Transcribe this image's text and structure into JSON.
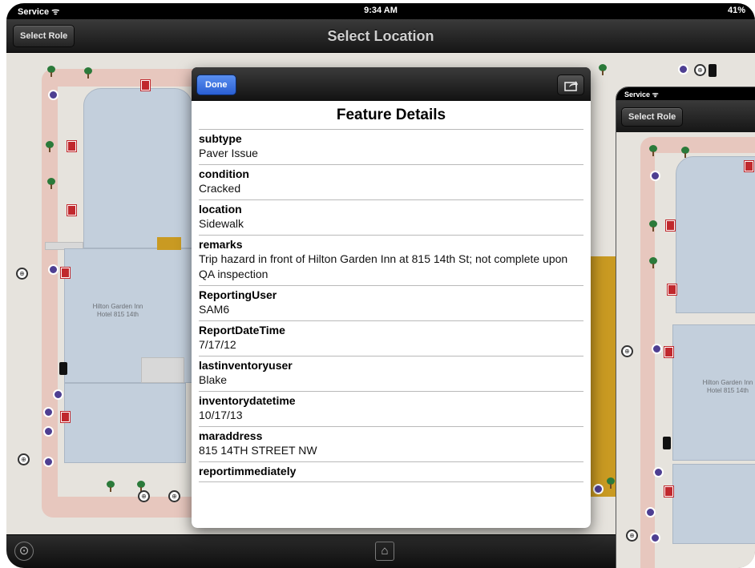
{
  "status_bar": {
    "carrier": "Service",
    "time": "9:34 AM",
    "battery": "41%"
  },
  "nav": {
    "left_button": "Select Role",
    "title": "Select Location"
  },
  "map": {
    "hotel_label": "Hilton Garden Inn Hotel 815 14th"
  },
  "popover": {
    "done_label": "Done",
    "title": "Feature Details",
    "fields": [
      {
        "key": "subtype",
        "value": "Paver Issue"
      },
      {
        "key": "condition",
        "value": "Cracked"
      },
      {
        "key": "location",
        "value": "Sidewalk"
      },
      {
        "key": "remarks",
        "value": "Trip hazard in front of Hilton Garden Inn at 815 14th St; not complete upon QA inspection"
      },
      {
        "key": "ReportingUser",
        "value": "SAM6"
      },
      {
        "key": "ReportDateTime",
        "value": "7/17/12"
      },
      {
        "key": "lastinventoryuser",
        "value": "Blake"
      },
      {
        "key": "inventorydatetime",
        "value": "10/17/13"
      },
      {
        "key": "maraddress",
        "value": "815 14TH STREET NW"
      },
      {
        "key": "reportimmediately",
        "value": ""
      }
    ]
  },
  "inset": {
    "carrier": "Service",
    "left_button": "Select Role",
    "hotel_label": "Hilton Garden Inn Hotel 815 14th"
  },
  "toolbar": {
    "left_icon": "locate-icon",
    "center_icon": "home-icon"
  },
  "colors": {
    "done_blue": "#2a5fd3",
    "hazard_red": "#c0282d",
    "building_blue": "#c3cfdc",
    "path_pink": "#e7c7be"
  }
}
